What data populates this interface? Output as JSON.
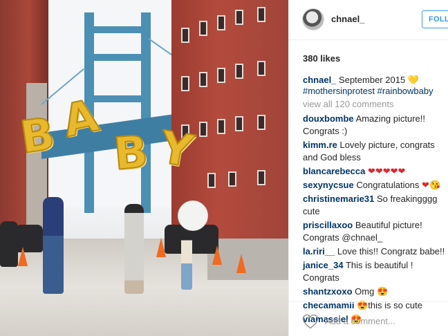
{
  "post": {
    "username": "chnael_",
    "follow_label": "FOLLOW",
    "likes": "380 likes",
    "caption": {
      "user": "chnael_",
      "text": "September 2015",
      "emoji": "💛",
      "hashtags": "#mothersinprotest #rainbowbaby"
    },
    "view_all": "view all 120 comments",
    "comments": [
      {
        "user": "douxbombe",
        "text": "Amazing picture!! Congrats :)"
      },
      {
        "user": "kimm.re",
        "text": "Lovely picture, congrats and God bless"
      },
      {
        "user": "blancarebecca",
        "text": "❤❤❤❤❤"
      },
      {
        "user": "sexynycsue",
        "text": "Congratulations",
        "emoji": "❤😘"
      },
      {
        "user": "christinemarie31",
        "text": "So freakingggg cute"
      },
      {
        "user": "priscillaxoo",
        "text": "Beautiful picture! Congrats @chnael_"
      },
      {
        "user": "la.riri__",
        "text": "Love this!! Congratz babe!!"
      },
      {
        "user": "janice_34",
        "text": "This is beautiful ! Congrats"
      },
      {
        "user": "shantzxoxo",
        "text": "Omg",
        "emoji": "😍"
      },
      {
        "user": "checamamii",
        "emoji_before": "😍",
        "text": "this is so cute"
      },
      {
        "user": "viamassiel",
        "emoji": "😍"
      }
    ],
    "add_comment_placeholder": "Add a comment...",
    "photo_balloon_letters": [
      "B",
      "A",
      "B",
      "Y"
    ]
  },
  "icons": {
    "like": "heart-outline-icon"
  },
  "colors": {
    "link": "#003569",
    "follow_blue": "#3897f0",
    "muted": "#999999",
    "text": "#262626"
  }
}
